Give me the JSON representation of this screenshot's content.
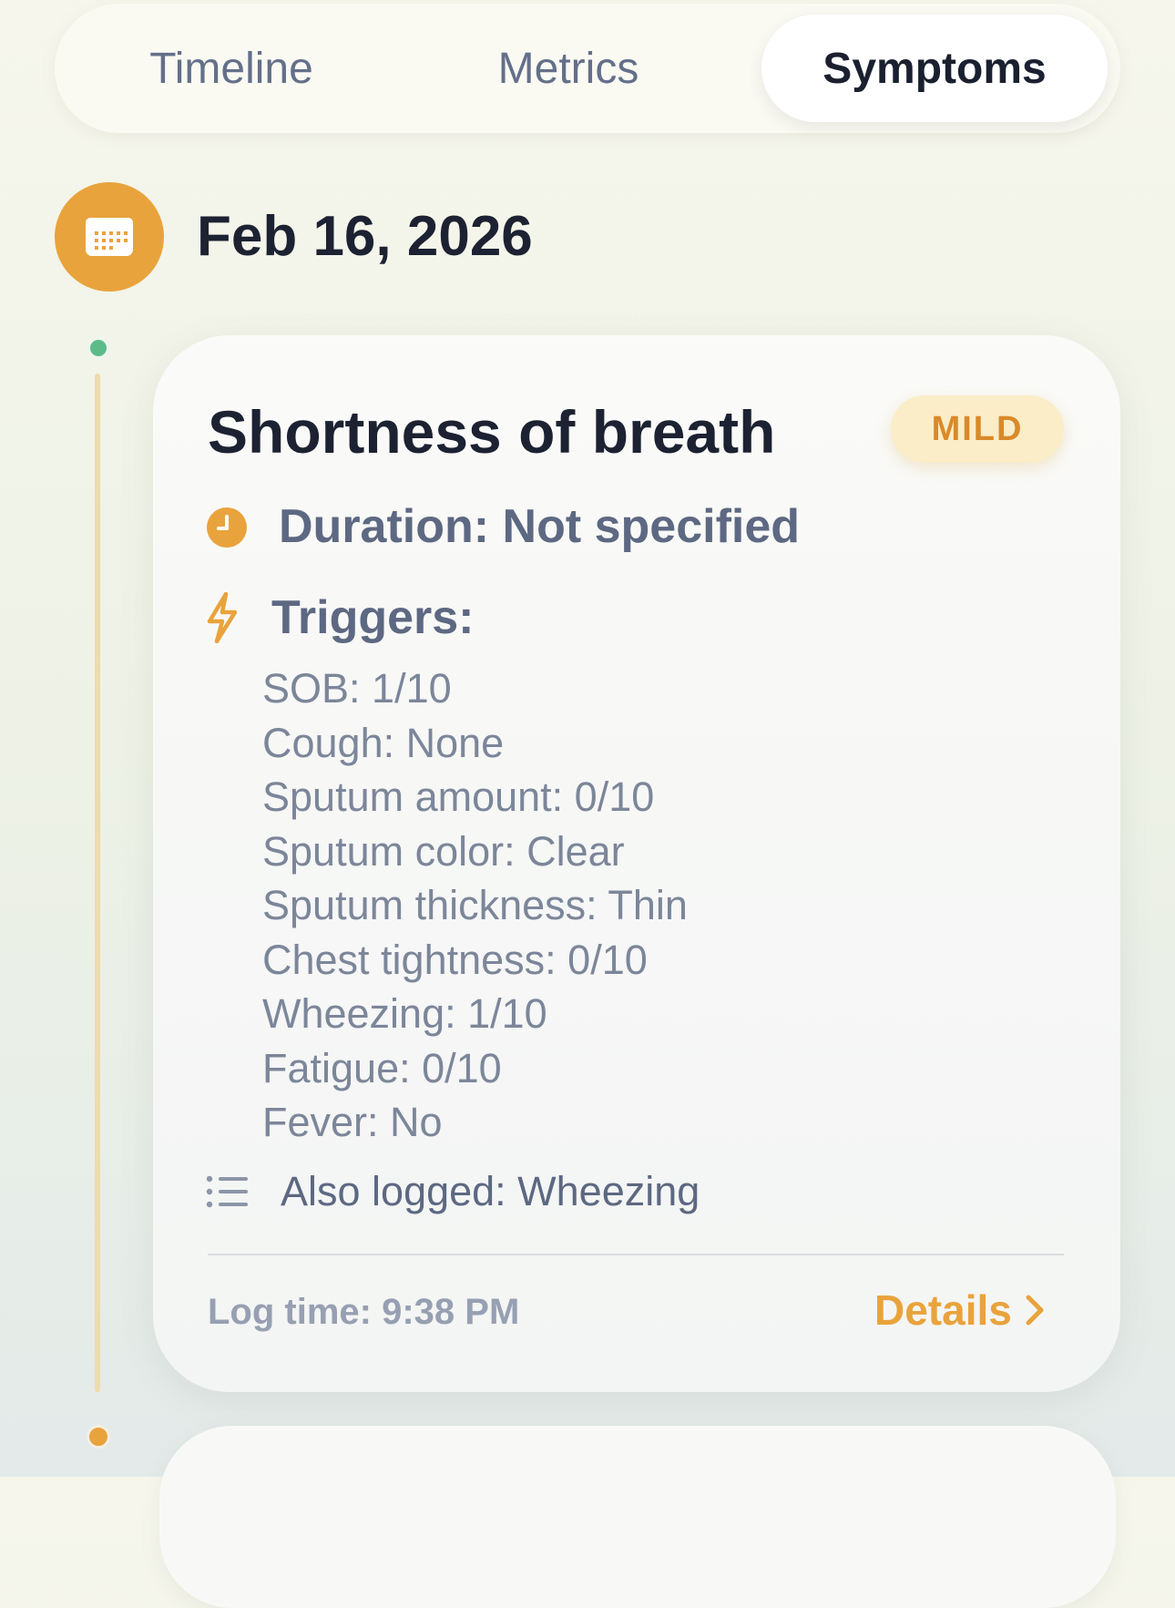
{
  "tabs": [
    {
      "label": "Timeline",
      "active": false
    },
    {
      "label": "Metrics",
      "active": false
    },
    {
      "label": "Symptoms",
      "active": true
    }
  ],
  "date_header": {
    "icon": "calendar-icon",
    "label": "Feb 16, 2026"
  },
  "entry": {
    "title": "Shortness of breath",
    "severity": "MILD",
    "duration": "Duration: Not specified",
    "triggers_label": "Triggers:",
    "triggers": [
      "SOB: 1/10",
      "Cough: None",
      "Sputum amount: 0/10",
      "Sputum color: Clear",
      "Sputum thickness: Thin",
      "Chest tightness: 0/10",
      "Wheezing: 1/10",
      "Fatigue: 0/10",
      "Fever: No"
    ],
    "also_logged": "Also logged: Wheezing",
    "log_time": "Log time: 9:38 PM",
    "details_label": "Details"
  },
  "colors": {
    "accent": "#e9a33c",
    "badge_bg": "#faedc8",
    "timeline_green": "#5dbb8a"
  }
}
